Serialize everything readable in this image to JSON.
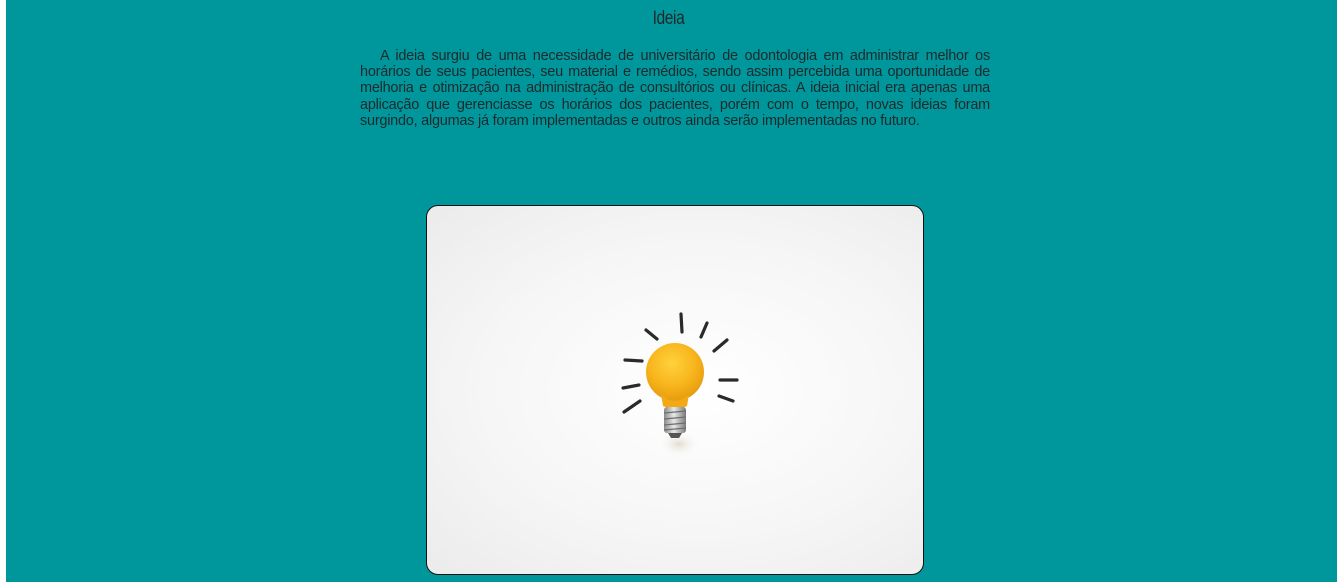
{
  "section": {
    "title": "Ideia",
    "paragraph": "A ideia surgiu de uma necessidade de universitário de odontologia em administrar melhor os horários de seus pacientes, seu material e remédios, sendo assim percebida uma oportunidade de melhoria e otimização na administração de consultórios ou clínicas. A ideia inicial era apenas uma aplicação que gerenciasse os horários dos pacientes, porém com o tempo, novas ideias foram surgindo, algumas já foram implementadas e outros ainda serão implementadas no futuro."
  },
  "image": {
    "subject": "lightbulb-illustration",
    "bulb_color": "#f7b21a",
    "background_color": "#00979c"
  }
}
